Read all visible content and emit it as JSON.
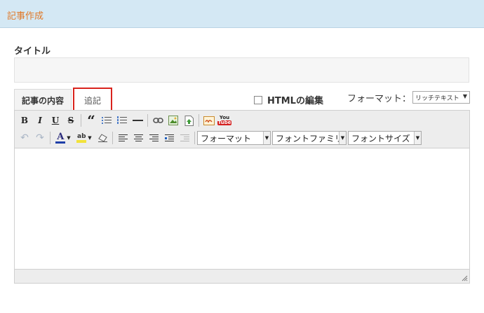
{
  "header": {
    "title": "記事作成"
  },
  "title_field": {
    "label": "タイトル",
    "value": "",
    "placeholder": ""
  },
  "tabs": [
    {
      "label": "記事の内容",
      "active": true
    },
    {
      "label": "追記",
      "active": false,
      "highlighted": true
    }
  ],
  "html_toggle": {
    "label": "HTMLの編集",
    "checked": false
  },
  "format": {
    "label": "フォーマット：",
    "selected": "リッチテキスト"
  },
  "toolbar": {
    "bold": "B",
    "italic": "I",
    "underline": "U",
    "strike": "S",
    "quote": "“",
    "font_color": "A",
    "highlight": "ab",
    "youtube_top": "You",
    "youtube_bottom": "Tube"
  },
  "dropdowns": {
    "format": "フォーマット",
    "font_family": "フォントファミリ",
    "font_size": "フォントサイズ"
  },
  "colors": {
    "header_bg": "#d4e8f4",
    "header_title": "#e07a2a",
    "highlight_border": "#d9231d",
    "editor_bg": "#ededed"
  }
}
